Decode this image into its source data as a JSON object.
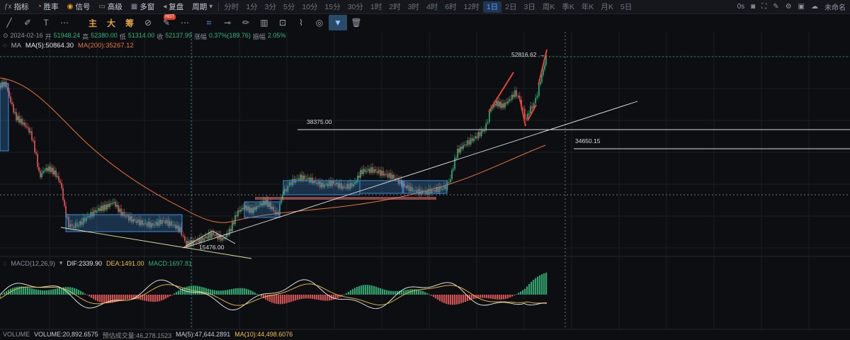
{
  "toolbar": {
    "items": [
      {
        "icon": "indicator-icon",
        "glyph": "ƒx",
        "label": "指标"
      },
      {
        "icon": "winrate-icon",
        "glyph": "◔",
        "label": "胜率",
        "highlight": true
      },
      {
        "icon": "signal-icon",
        "glyph": "◉",
        "label": "信号",
        "highlight": true
      },
      {
        "icon": "advanced-icon",
        "glyph": "▭",
        "label": "高级"
      },
      {
        "icon": "multi-grid-icon",
        "glyph": "▦",
        "label": "多窗"
      },
      {
        "icon": "replay-icon",
        "glyph": "◂",
        "label": "复盘"
      },
      {
        "icon": "period-icon",
        "glyph": "",
        "label": "周期"
      }
    ],
    "periods": [
      "分时",
      "1分",
      "3分",
      "5分",
      "10分",
      "15分",
      "30分",
      "1时",
      "2时",
      "3时",
      "4时",
      "6时",
      "12时",
      "1日",
      "2日",
      "3日",
      "周K",
      "季K",
      "年K",
      "月K",
      "5日"
    ],
    "active_period": "1日",
    "right": {
      "countdown": "0s",
      "user_label": "未命名"
    }
  },
  "draw_tools": {
    "chinese": [
      "主",
      "大",
      "筹"
    ],
    "hot_badge": "HOT"
  },
  "info": {
    "date": "2024-02-16",
    "open_label": "开",
    "open": "51948.24",
    "high_label": "高",
    "high": "52380.00",
    "low_label": "低",
    "low": "51314.00",
    "close_label": "收",
    "close": "52137.99",
    "change_label": "涨幅",
    "change": "0.37%(189.76)",
    "amplitude_label": "振幅",
    "amplitude": "2.05%"
  },
  "ma_legend": {
    "name": "MA",
    "ma5": "MA(5):50864.30",
    "ma200": "MA(200):35267.12"
  },
  "macd_legend": {
    "name": "MACD(12,26,9)",
    "dif": "DIF:2339.90",
    "dea": "DEA:1491.00",
    "macd": "MACD:1697.81"
  },
  "volume_legend": {
    "name": "VOLUME",
    "volume": "VOLUME:20,892.6575",
    "forecast": "预估成交量:46,278.1523",
    "ma5": "MA(5):47,644.2891",
    "ma10": "MA(10):44,498.6076"
  },
  "chart_data": {
    "type": "line",
    "title": "",
    "price_labels": {
      "high_marker": "52816.62",
      "level_upper": "38375.00",
      "level_right": "34650.15",
      "low_marker": "15476.00"
    },
    "ma_colors": {
      "ma5": "#e8e8e8",
      "ma200": "#e8743a"
    },
    "colors": {
      "up": "#2fb57a",
      "down": "#e05a5a",
      "box": "#3d8fd6",
      "annotation": "#e8403a",
      "dif": "#f0f0f0",
      "dea": "#f0c040"
    }
  }
}
